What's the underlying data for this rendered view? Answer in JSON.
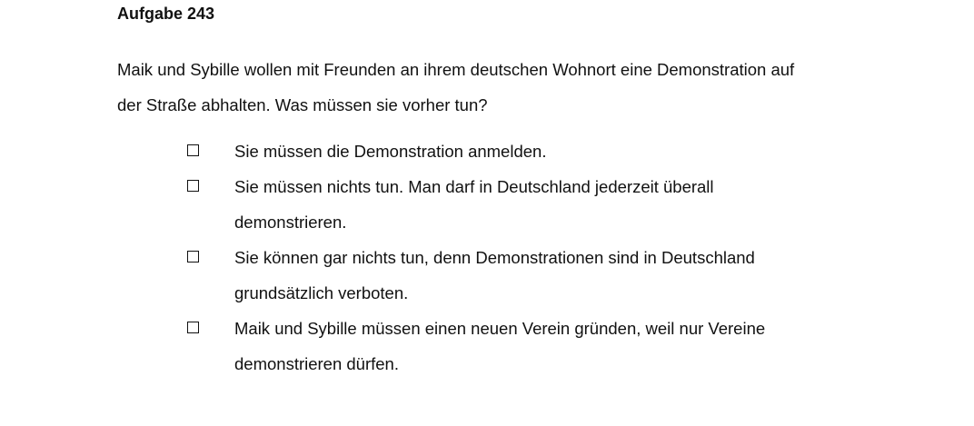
{
  "task": {
    "title": "Aufgabe 243",
    "question_lines": [
      "Maik und Sybille wollen mit Freunden an ihrem deutschen Wohnort eine Demonstration auf",
      "der Straße abhalten. Was müssen sie vorher tun?"
    ]
  },
  "options": [
    {
      "lines": [
        "Sie müssen die Demonstration anmelden."
      ],
      "checked": false
    },
    {
      "lines": [
        "Sie müssen nichts tun. Man darf in Deutschland jederzeit überall",
        "demonstrieren."
      ],
      "checked": false
    },
    {
      "lines": [
        "Sie können gar nichts tun, denn Demonstrationen sind in Deutschland",
        "grundsätzlich verboten."
      ],
      "checked": false
    },
    {
      "lines": [
        "Maik und Sybille müssen einen neuen Verein gründen, weil nur Vereine",
        "demonstrieren dürfen."
      ],
      "checked": false
    }
  ]
}
